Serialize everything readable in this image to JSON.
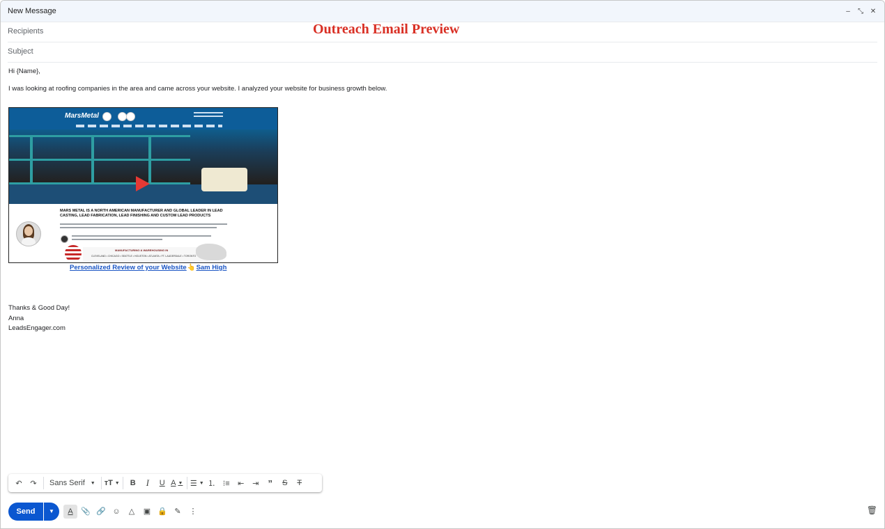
{
  "window": {
    "title": "New Message"
  },
  "titlebar_controls": {
    "minimize": "–",
    "expand": "⤡",
    "close": "✕"
  },
  "fields": {
    "recipients_placeholder": "Recipients",
    "subject_placeholder": "Subject"
  },
  "preview_title": "Outreach Email Preview",
  "body": {
    "greeting": "Hi {Name},",
    "intro": "I was looking at roofing companies in the area and came across your website. I analyzed your website for business growth below."
  },
  "screenshot": {
    "logo": "MarsMetal",
    "headline": "MARS METAL IS A NORTH AMERICAN MANUFACTURER AND GLOBAL LEADER IN LEAD CASTING, LEAD FABRICATION, LEAD FINISHING AND CUSTOM LEAD PRODUCTS",
    "mfg_title": "MANUFACTURING & WAREHOUSING IN",
    "cities": "CLEVELAND • CHICAGO • SEATTLE • HOUSTON • ATLANTA • FT. LAUDERDALE • TORONTO"
  },
  "review_link": {
    "part1": "Personalized Review of your Website",
    "hand": "👆",
    "part2": "Sam High"
  },
  "signoff": {
    "line1": "Thanks & Good Day!",
    "line2": "Anna",
    "line3": "LeadsEngager.com"
  },
  "format_toolbar": {
    "font": "Sans Serif"
  },
  "send_button": {
    "label": "Send"
  }
}
